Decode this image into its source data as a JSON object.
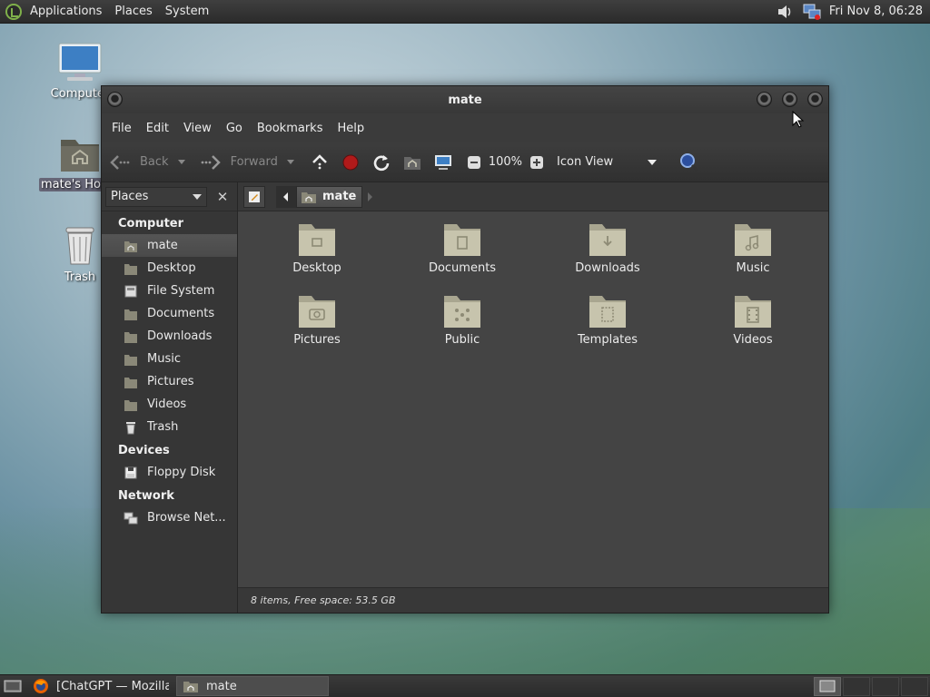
{
  "top_panel": {
    "menu": [
      "Applications",
      "Places",
      "System"
    ],
    "clock": "Fri Nov  8, 06:28"
  },
  "desktop": {
    "icons": [
      {
        "label": "Computer",
        "icon": "computer-icon"
      },
      {
        "label": "mate's Home",
        "icon": "home-folder-icon"
      },
      {
        "label": "Trash",
        "icon": "trash-icon"
      }
    ]
  },
  "window": {
    "title": "mate",
    "menubar": [
      "File",
      "Edit",
      "View",
      "Go",
      "Bookmarks",
      "Help"
    ],
    "toolbar": {
      "back": "Back",
      "forward": "Forward",
      "zoom": "100%",
      "view_mode": "Icon View"
    },
    "sidebar": {
      "selector": "Places",
      "groups": [
        {
          "name": "Computer",
          "items": [
            "mate",
            "Desktop",
            "File System",
            "Documents",
            "Downloads",
            "Music",
            "Pictures",
            "Videos",
            "Trash"
          ]
        },
        {
          "name": "Devices",
          "items": [
            "Floppy Disk"
          ]
        },
        {
          "name": "Network",
          "items": [
            "Browse Net..."
          ]
        }
      ]
    },
    "pathbar": {
      "crumb": "mate"
    },
    "files": [
      "Desktop",
      "Documents",
      "Downloads",
      "Music",
      "Pictures",
      "Public",
      "Templates",
      "Videos"
    ],
    "status": "8 items, Free space: 53.5 GB"
  },
  "taskbar": {
    "tasks": [
      "[ChatGPT — Mozilla ...",
      "mate"
    ]
  },
  "colors": {
    "panel": "#2f2f2f",
    "window_bg": "#444444",
    "folder": "#c7c4ad",
    "record": "#b01a1a"
  }
}
